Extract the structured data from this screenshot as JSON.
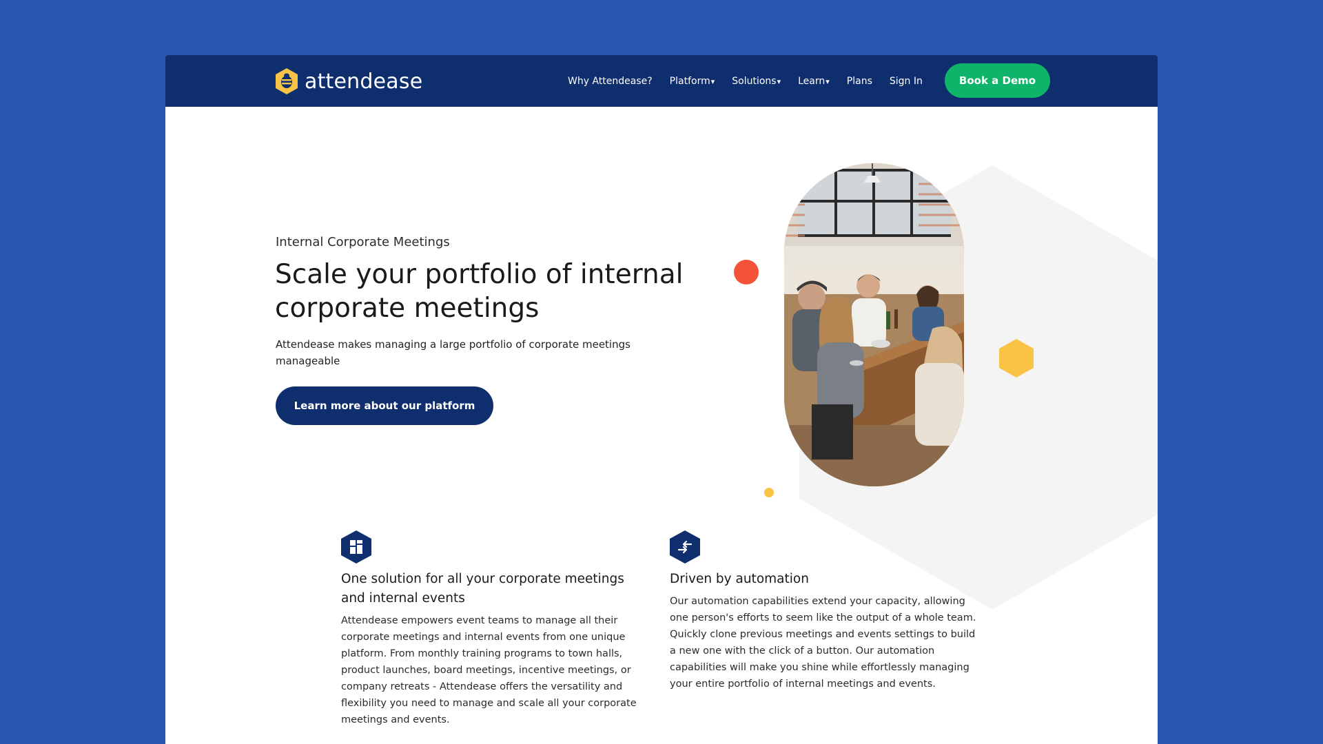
{
  "brand": {
    "name": "attendease",
    "icon": "bee-hexagon-logo-icon"
  },
  "nav": {
    "items": [
      {
        "label": "Why Attendease?",
        "has_dropdown": false
      },
      {
        "label": "Platform",
        "has_dropdown": true
      },
      {
        "label": "Solutions",
        "has_dropdown": true
      },
      {
        "label": "Learn",
        "has_dropdown": true
      },
      {
        "label": "Plans",
        "has_dropdown": false
      },
      {
        "label": "Sign In",
        "has_dropdown": false
      }
    ],
    "dropdown_glyph": "▾",
    "cta_label": "Book a Demo"
  },
  "hero": {
    "eyebrow": "Internal Corporate Meetings",
    "headline": "Scale your portfolio of internal corporate meetings",
    "subtitle": "Attendease makes managing a large portfolio of corporate meetings manageable",
    "button_label": "Learn more about our platform"
  },
  "features": [
    {
      "icon": "grid-layout-icon",
      "title": "One solution for all your corporate meetings and internal events",
      "body": "Attendease empowers event teams to manage all their corporate meetings and internal events from one unique platform. From monthly training programs to town halls, product launches, board meetings, incentive meetings, or company retreats - Attendease offers the versatility and flexibility you need to manage and scale all your corporate meetings and events."
    },
    {
      "icon": "swap-arrows-icon",
      "title": "Driven by automation",
      "body": "Our automation capabilities extend your capacity, allowing one person's efforts to seem like the output of a whole team. Quickly clone previous meetings and events settings to build a new one with the click of a button. Our automation capabilities will make you shine while effortlessly managing your entire portfolio of internal meetings and events."
    }
  ],
  "colors": {
    "background": "#2a56b2",
    "navbar": "#0f2e6e",
    "cta_green": "#0fb46b",
    "accent_red": "#f4533a",
    "accent_yellow": "#f9c445",
    "hex_gray": "#f4f4f4"
  }
}
